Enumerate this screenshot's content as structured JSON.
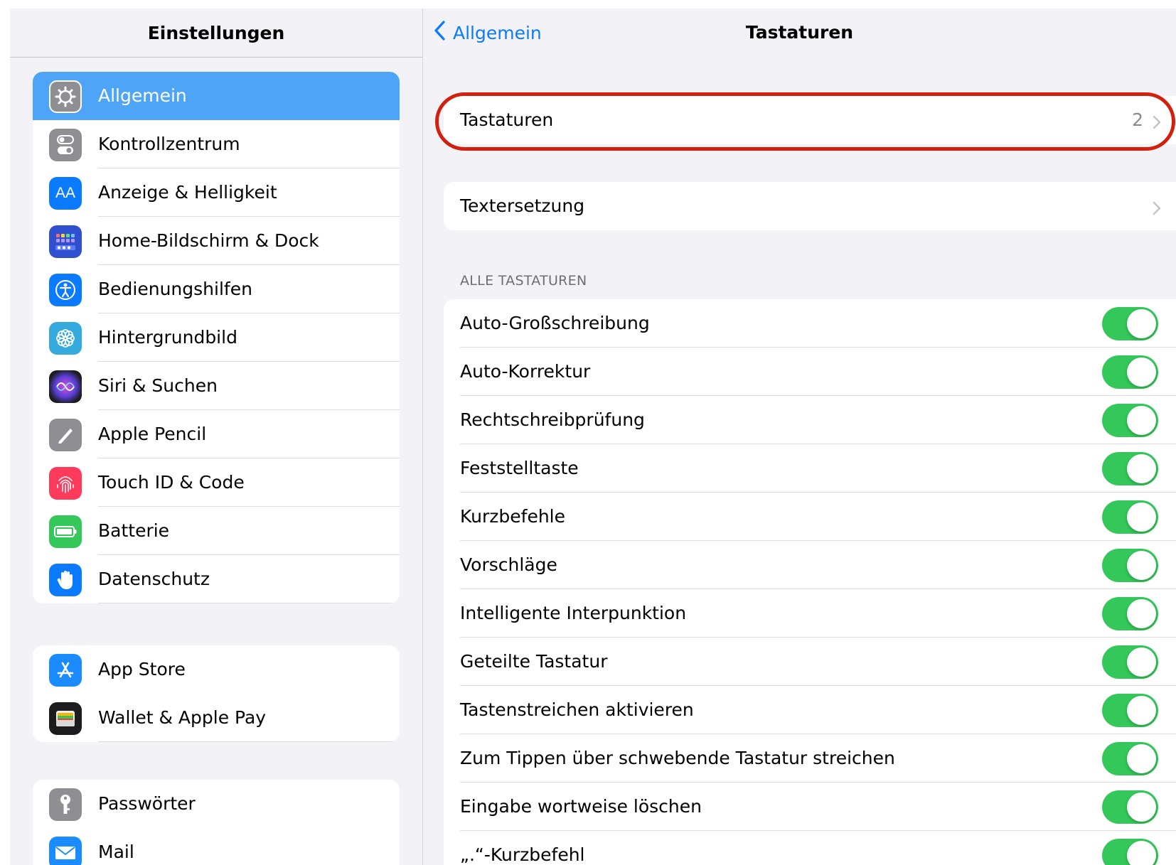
{
  "sidebar": {
    "title": "Einstellungen",
    "groups": [
      {
        "items": [
          {
            "label": "Allgemein",
            "icon": "gear-icon",
            "color": "#8e8e93",
            "selected": true
          },
          {
            "label": "Kontrollzentrum",
            "icon": "switches-icon",
            "color": "#8e8e93"
          },
          {
            "label": "Anzeige & Helligkeit",
            "icon": "text-size-icon",
            "color": "#0a7aff"
          },
          {
            "label": "Home-Bildschirm & Dock",
            "icon": "home-grid-icon",
            "color": "#2f4fd1"
          },
          {
            "label": "Bedienungshilfen",
            "icon": "accessibility-icon",
            "color": "#0a7aff"
          },
          {
            "label": "Hintergrundbild",
            "icon": "flower-icon",
            "color": "#35aadc"
          },
          {
            "label": "Siri & Suchen",
            "icon": "siri-icon",
            "color": "#222"
          },
          {
            "label": "Apple Pencil",
            "icon": "pencil-icon",
            "color": "#8e8e93"
          },
          {
            "label": "Touch ID & Code",
            "icon": "fingerprint-icon",
            "color": "#ff3b30"
          },
          {
            "label": "Batterie",
            "icon": "battery-icon",
            "color": "#34c759"
          },
          {
            "label": "Datenschutz",
            "icon": "hand-icon",
            "color": "#0a7aff"
          }
        ]
      },
      {
        "items": [
          {
            "label": "App Store",
            "icon": "app-store-icon",
            "color": "#1a8cff"
          },
          {
            "label": "Wallet & Apple Pay",
            "icon": "wallet-icon",
            "color": "#1c1c1e"
          }
        ]
      },
      {
        "items": [
          {
            "label": "Passwörter",
            "icon": "key-icon",
            "color": "#8e8e93"
          },
          {
            "label": "Mail",
            "icon": "mail-icon",
            "color": "#1a8cff"
          }
        ]
      }
    ]
  },
  "detail": {
    "back_label": "Allgemein",
    "title": "Tastaturen",
    "keyboards": {
      "label": "Tastaturen",
      "value": "2"
    },
    "text_replacement": {
      "label": "Textersetzung"
    },
    "section_header": "ALLE TASTATUREN",
    "toggles": [
      {
        "label": "Auto-Großschreibung",
        "on": true
      },
      {
        "label": "Auto-Korrektur",
        "on": true
      },
      {
        "label": "Rechtschreibprüfung",
        "on": true
      },
      {
        "label": "Feststelltaste",
        "on": true
      },
      {
        "label": "Kurzbefehle",
        "on": true
      },
      {
        "label": "Vorschläge",
        "on": true
      },
      {
        "label": "Intelligente Interpunktion",
        "on": true
      },
      {
        "label": "Geteilte Tastatur",
        "on": true
      },
      {
        "label": "Tastenstreichen aktivieren",
        "on": true
      },
      {
        "label": "Zum Tippen über schwebende Tastatur streichen",
        "on": true
      },
      {
        "label": "Eingabe wortweise löschen",
        "on": true
      },
      {
        "label": "„.“-Kurzbefehl",
        "on": true
      }
    ]
  },
  "colors": {
    "accent": "#0a7aff",
    "selected_row": "#4ea4f6",
    "toggle_on": "#34c759",
    "highlight": "#d3200e"
  }
}
